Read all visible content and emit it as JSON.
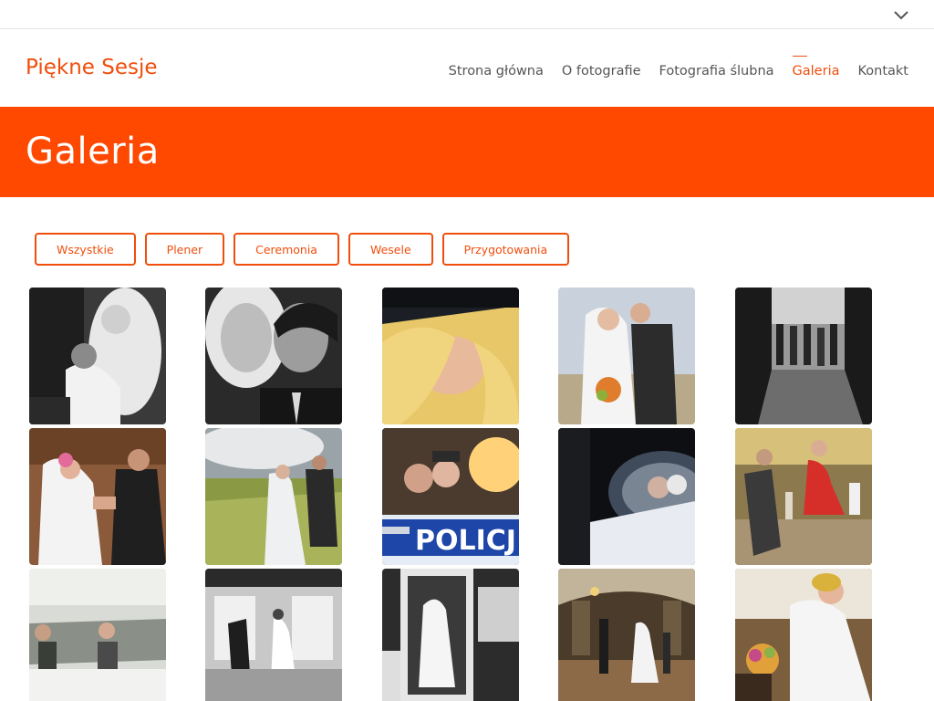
{
  "site": {
    "logo": "Piękne Sesje"
  },
  "nav": {
    "items": [
      {
        "label": "Strona główna"
      },
      {
        "label": "O fotografie"
      },
      {
        "label": "Fotografia ślubna"
      },
      {
        "label": "Galeria",
        "active": true
      },
      {
        "label": "Kontakt"
      }
    ]
  },
  "banner": {
    "title": "Galeria"
  },
  "filters": {
    "items": [
      {
        "label": "Wszystkie",
        "active": true
      },
      {
        "label": "Plener"
      },
      {
        "label": "Ceremonia"
      },
      {
        "label": "Wesele"
      },
      {
        "label": "Przygotowania"
      }
    ]
  },
  "gallery": {
    "photos": [
      {
        "subject": "bride-in-car-bw"
      },
      {
        "subject": "couple-closeup-bw"
      },
      {
        "subject": "bride-blonde-smiling"
      },
      {
        "subject": "couple-kiss-outdoor"
      },
      {
        "subject": "wedding-guests-bw"
      },
      {
        "subject": "couple-rings"
      },
      {
        "subject": "couple-wheat-field"
      },
      {
        "subject": "couple-police-car",
        "overlay_text": "POLICJ"
      },
      {
        "subject": "couple-mirror-reflection"
      },
      {
        "subject": "wedding-dance-party"
      },
      {
        "subject": "couple-car-mirror"
      },
      {
        "subject": "groom-kiss-hand-bw"
      },
      {
        "subject": "bride-mirror-bw"
      },
      {
        "subject": "church-ceremony"
      },
      {
        "subject": "bride-flowers"
      }
    ]
  },
  "colors": {
    "accent": "#f04e0c",
    "banner": "#ff4800"
  }
}
